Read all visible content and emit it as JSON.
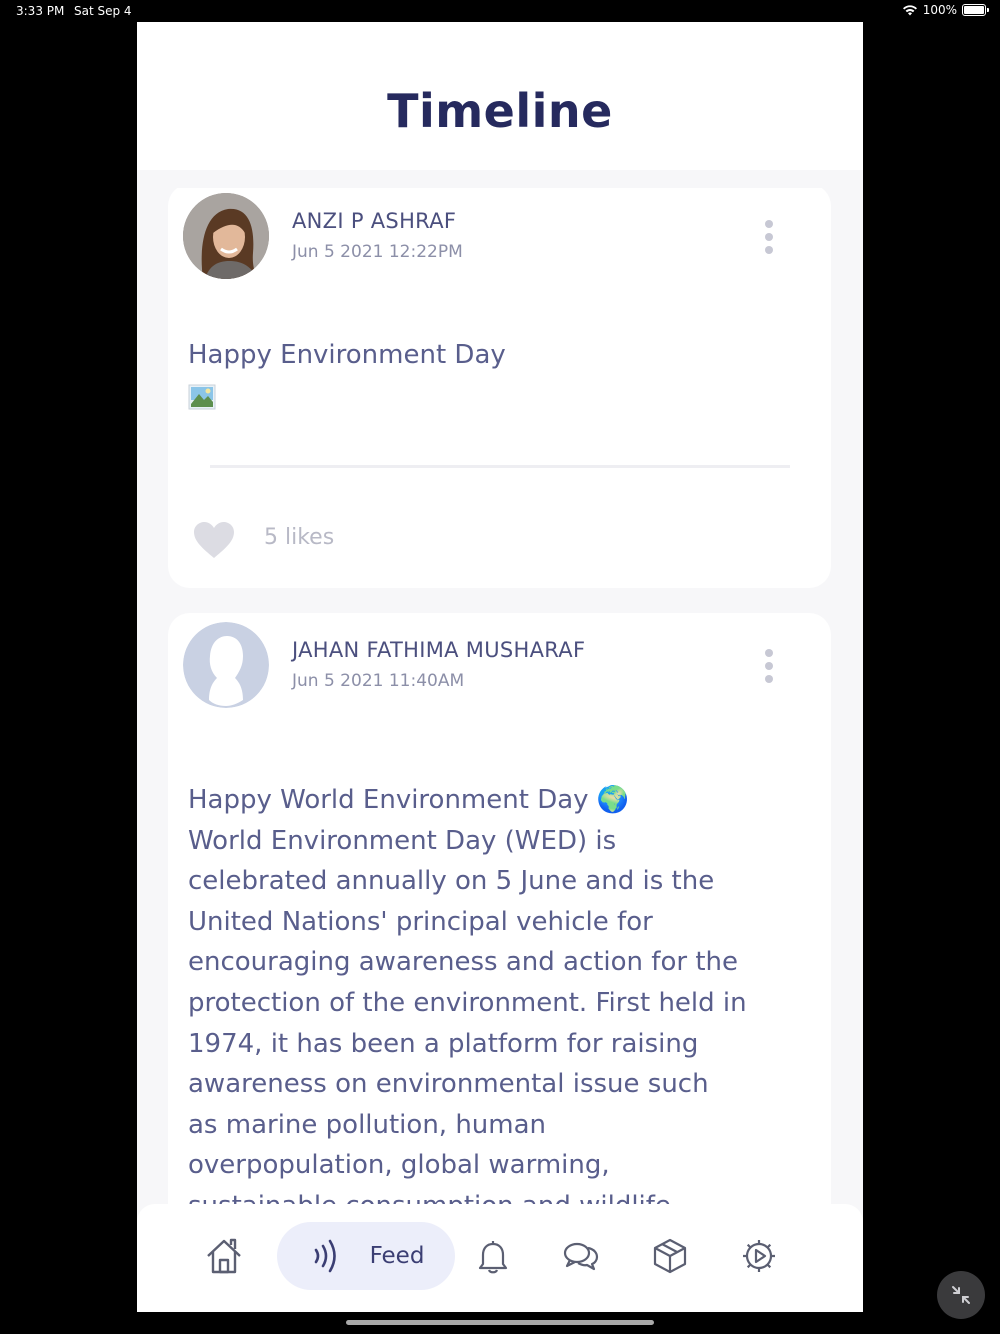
{
  "status_bar": {
    "time": "3:33 PM",
    "date": "Sat Sep 4",
    "battery": "100%"
  },
  "header": {
    "title": "Timeline"
  },
  "posts": [
    {
      "author": "ANZI P ASHRAF",
      "timestamp": "Jun  5 2021 12:22PM",
      "text": "Happy Environment Day",
      "likes": "5 likes",
      "avatar": "profile-photo"
    },
    {
      "author": "JAHAN FATHIMA MUSHARAF",
      "timestamp": "Jun  5 2021 11:40AM",
      "text_lines": [
        "Happy World Environment Day 🌍",
        "World Environment Day (WED) is",
        "celebrated annually on 5 June and is the",
        "United Nations' principal vehicle for",
        "encouraging awareness and action for the",
        "protection of the environment. First held in",
        "1974, it has been a platform for raising",
        "awareness on environmental issue such",
        "as marine pollution, human",
        "overpopulation, global warming,",
        "sustainable consumption and wildlife"
      ],
      "avatar": "default-avatar"
    }
  ],
  "nav": {
    "items": [
      {
        "icon": "home-icon"
      },
      {
        "icon": "feed-icon",
        "label": "Feed",
        "active": true
      },
      {
        "icon": "bell-icon"
      },
      {
        "icon": "chat-icon"
      },
      {
        "icon": "box-icon"
      },
      {
        "icon": "settings-icon"
      }
    ]
  },
  "colors": {
    "title": "#262a5e",
    "text": "#595e8c",
    "accent_bg": "#eceefa",
    "background": "#000000"
  }
}
